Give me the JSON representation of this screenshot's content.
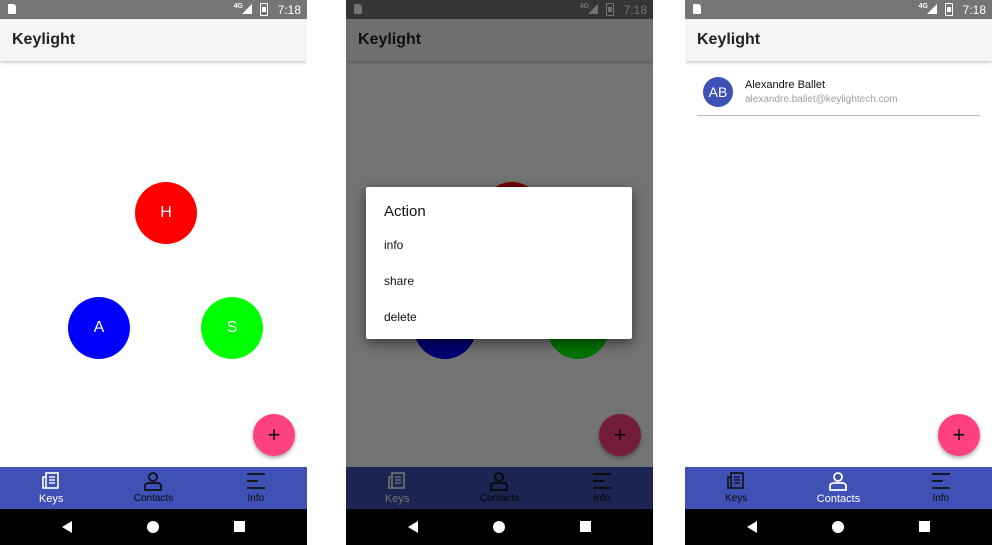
{
  "status_bar": {
    "network": "4G",
    "time": "7:18"
  },
  "app": {
    "title": "Keylight"
  },
  "screen1": {
    "keys": [
      {
        "letter": "H",
        "color": "#ff0000"
      },
      {
        "letter": "A",
        "color": "#0000ff"
      },
      {
        "letter": "S",
        "color": "#00ff00"
      }
    ]
  },
  "dialog": {
    "title": "Action",
    "items": [
      "info",
      "share",
      "delete"
    ]
  },
  "contacts": [
    {
      "initials": "AB",
      "name": "Alexandre Ballet",
      "email": "alexandre.ballet@keylightech.com"
    }
  ],
  "fab_symbol": "+",
  "nav": {
    "keys": "Keys",
    "contacts": "Contacts",
    "info": "Info"
  },
  "colors": {
    "primary": "#3f51b5",
    "accent": "#ff4081"
  },
  "icons": {
    "keys": "keys-tab-icon",
    "contacts": "person-icon",
    "info": "info-lines-icon",
    "back": "back-triangle-icon",
    "home": "home-circle-icon",
    "recent": "recent-square-icon"
  }
}
